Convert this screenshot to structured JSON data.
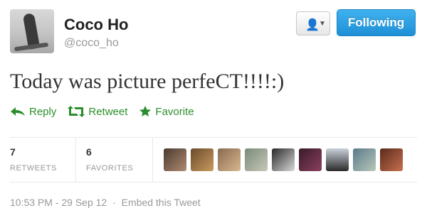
{
  "profile": {
    "name": "Coco Ho",
    "handle": "@coco_ho"
  },
  "buttons": {
    "follow_menu_icon": "person-icon",
    "following_label": "Following"
  },
  "tweet": {
    "text": "Today was picture perfeCT!!!!:)"
  },
  "actions": {
    "reply": "Reply",
    "retweet": "Retweet",
    "favorite": "Favorite"
  },
  "stats": {
    "retweets": {
      "count": "7",
      "label": "RETWEETS"
    },
    "favorites": {
      "count": "6",
      "label": "FAVORITES"
    }
  },
  "favoriters_count_shown": 9,
  "footer": {
    "timestamp": "10:53 PM - 29 Sep 12",
    "separator": "·",
    "embed": "Embed this Tweet"
  },
  "colors": {
    "action_green": "#2b8e2b",
    "following_blue": "#2a9fe3"
  }
}
